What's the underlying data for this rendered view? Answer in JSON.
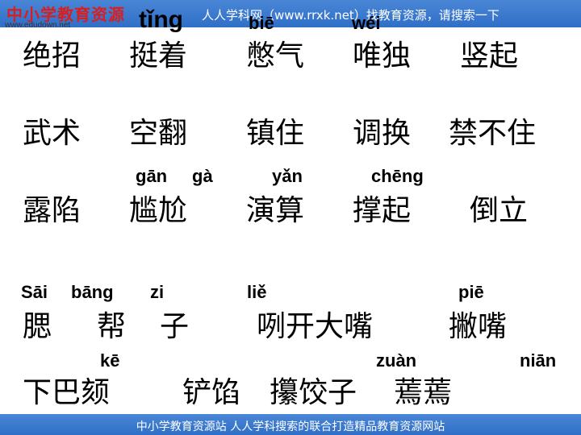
{
  "header": {
    "logo": "中小学教育资源",
    "logo_url": "www.edudown.net",
    "banner": "人人学科网（www.rrxk.net）找教育资源，请搜索一下"
  },
  "footer": {
    "text": "中小学教育资源站 人人学科搜索的联合打造精品教育资源网站"
  },
  "rows": [
    {
      "pinyin": [
        "tǐng",
        "biē",
        "wéi"
      ],
      "words": [
        "绝招",
        "挺着",
        "憋气",
        "唯独",
        "竖起"
      ]
    },
    {
      "pinyin": [],
      "words": [
        "武术",
        "空翻",
        "镇住",
        "调换",
        "禁不住"
      ]
    },
    {
      "pinyin": [
        "gān",
        "gà",
        "yǎn",
        "chēng"
      ],
      "words": [
        "露陷",
        "尴尬",
        "演算",
        "撑起",
        "倒立"
      ]
    },
    {
      "pinyin": [
        "Sāi",
        "bāng",
        "zi",
        "liě",
        "piē"
      ],
      "words": [
        "腮",
        "帮",
        "子",
        "咧开大嘴",
        "撇嘴"
      ]
    },
    {
      "pinyin": [
        "kē",
        "zuàn",
        "niān"
      ],
      "words": [
        "下巴颏",
        "铲馅",
        "攥饺子",
        "蔫蔫"
      ]
    }
  ]
}
